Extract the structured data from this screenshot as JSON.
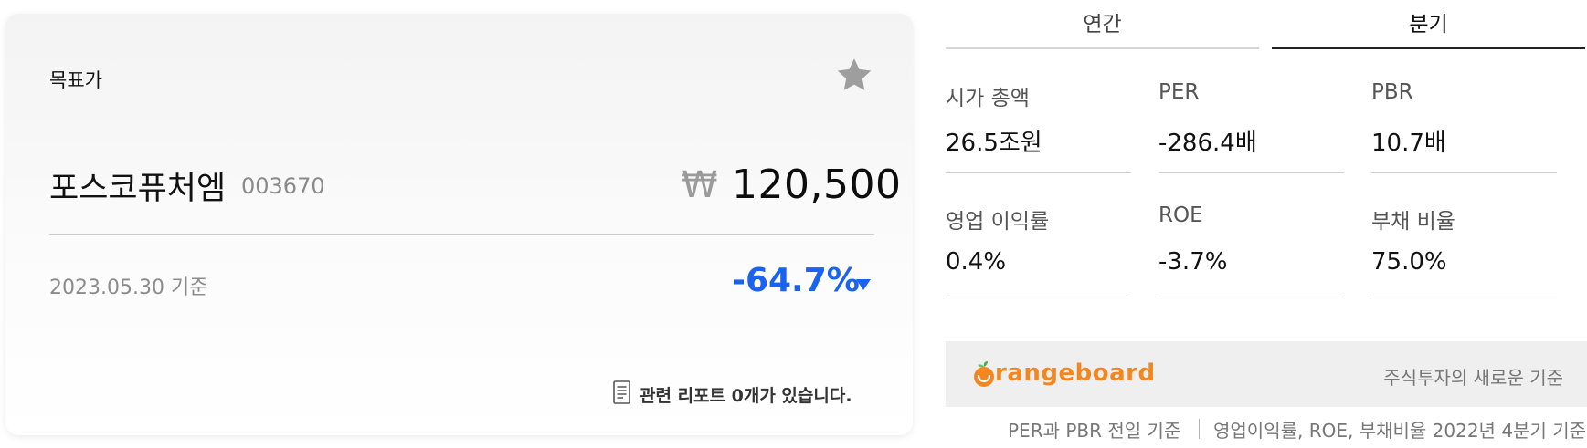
{
  "card": {
    "label": "목표가",
    "company_name": "포스코퓨처엠",
    "company_code": "003670",
    "currency_symbol": "₩",
    "target_price": "120,500",
    "base_date": "2023.05.30 기준",
    "change_rate": "-64.7%",
    "change_direction_icon": "down-triangle-icon",
    "report_link": "관련 리포트 0개가 있습니다.",
    "star_icon": "star-icon",
    "colors": {
      "down": "#1a62f0",
      "star": "#9e9e9e"
    }
  },
  "tabs": [
    {
      "label": "연간",
      "active": false
    },
    {
      "label": "분기",
      "active": true
    }
  ],
  "metrics": [
    {
      "label": "시가 총액",
      "value": "26.5조원"
    },
    {
      "label": "PER",
      "value": "-286.4배"
    },
    {
      "label": "PBR",
      "value": "10.7배"
    },
    {
      "label": "영업 이익률",
      "value": "0.4%"
    },
    {
      "label": "ROE",
      "value": "-3.7%"
    },
    {
      "label": "부채 비율",
      "value": "75.0%"
    }
  ],
  "banner": {
    "brand": "rangeboard",
    "logo_icon": "orange-fruit-icon",
    "slogan": "주식투자의 새로운 기준",
    "brand_color": "#f4861f"
  },
  "footnote": {
    "left": "PER과 PBR 전일 기준",
    "right": "영업이익률, ROE, 부채비율 2022년 4분기 기준"
  }
}
